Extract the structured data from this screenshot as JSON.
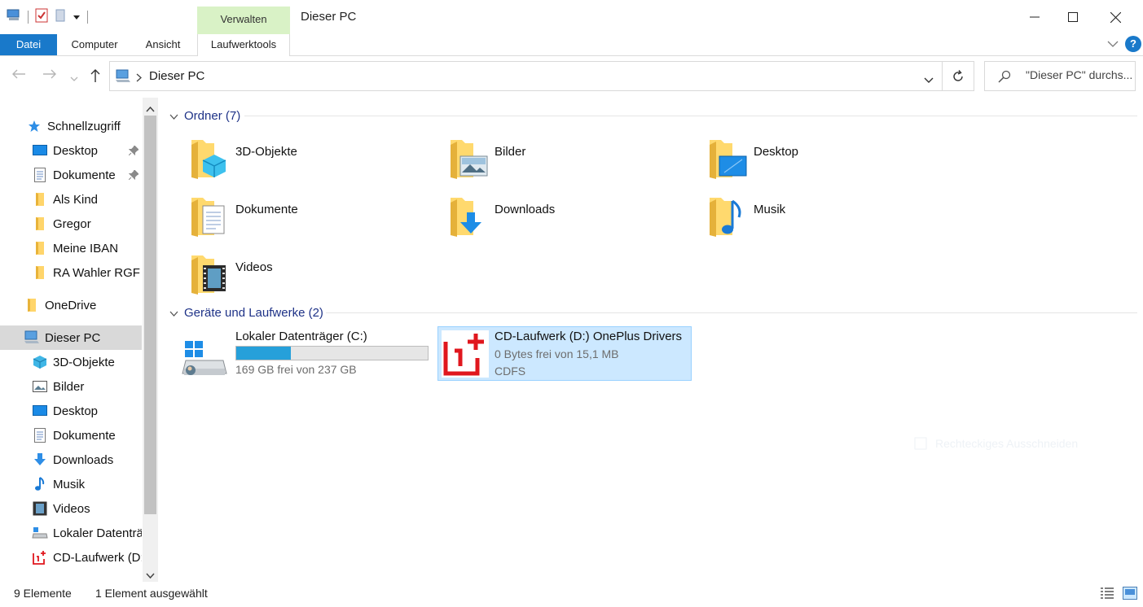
{
  "window": {
    "title": "Dieser PC",
    "context_tab": "Verwalten"
  },
  "ribbon": {
    "tabs": [
      "Datei",
      "Computer",
      "Ansicht",
      "Laufwerktools"
    ],
    "help": "?"
  },
  "address": {
    "crumb": "Dieser PC",
    "search_placeholder": "\"Dieser PC\" durchs..."
  },
  "sidebar": {
    "quick_access": "Schnellzugriff",
    "items": [
      {
        "label": "Desktop",
        "icon": "desktop-icon",
        "pinned": true
      },
      {
        "label": "Dokumente",
        "icon": "documents-icon",
        "pinned": true
      },
      {
        "label": "Als Kind",
        "icon": "folder-icon"
      },
      {
        "label": "Gregor",
        "icon": "folder-icon"
      },
      {
        "label": "Meine IBAN",
        "icon": "folder-icon"
      },
      {
        "label": "RA Wahler RGF",
        "icon": "folder-icon"
      }
    ],
    "onedrive": "OneDrive",
    "this_pc": "Dieser PC",
    "pc_items": [
      {
        "label": "3D-Objekte",
        "icon": "3d-objects-icon"
      },
      {
        "label": "Bilder",
        "icon": "pictures-icon"
      },
      {
        "label": "Desktop",
        "icon": "desktop-icon"
      },
      {
        "label": "Dokumente",
        "icon": "documents-icon"
      },
      {
        "label": "Downloads",
        "icon": "downloads-icon"
      },
      {
        "label": "Musik",
        "icon": "music-icon"
      },
      {
        "label": "Videos",
        "icon": "videos-icon"
      },
      {
        "label": "Lokaler Datenträ",
        "icon": "local-disk-icon"
      },
      {
        "label": "CD-Laufwerk (D:",
        "icon": "oneplus-drive-icon"
      }
    ]
  },
  "main": {
    "folders_header": "Ordner (7)",
    "folders": [
      {
        "label": "3D-Objekte",
        "icon": "3d-objects-folder-icon"
      },
      {
        "label": "Bilder",
        "icon": "pictures-folder-icon"
      },
      {
        "label": "Desktop",
        "icon": "desktop-folder-icon"
      },
      {
        "label": "Dokumente",
        "icon": "documents-folder-icon"
      },
      {
        "label": "Downloads",
        "icon": "downloads-folder-icon"
      },
      {
        "label": "Musik",
        "icon": "music-folder-icon"
      },
      {
        "label": "Videos",
        "icon": "videos-folder-icon"
      }
    ],
    "drives_header": "Geräte und Laufwerke (2)",
    "drives": [
      {
        "name": "Lokaler Datenträger (C:)",
        "free": "169 GB frei von 237 GB",
        "used_fraction": 0.287,
        "icon": "windows-drive-icon"
      },
      {
        "name": "CD-Laufwerk (D:) OnePlus Drivers",
        "free": "0 Bytes frei von 15,1 MB",
        "fs": "CDFS",
        "icon": "oneplus-logo-icon",
        "selected": true
      }
    ],
    "ghost_text": "Rechteckiges Ausschneiden"
  },
  "status": {
    "count": "9 Elemente",
    "selection": "1 Element ausgewählt"
  },
  "colors": {
    "accent": "#1979ca",
    "selection": "#cce8ff",
    "section_header": "#1e3287",
    "drive_bar": "#26a0da",
    "context_tab": "#d9f2c6"
  }
}
